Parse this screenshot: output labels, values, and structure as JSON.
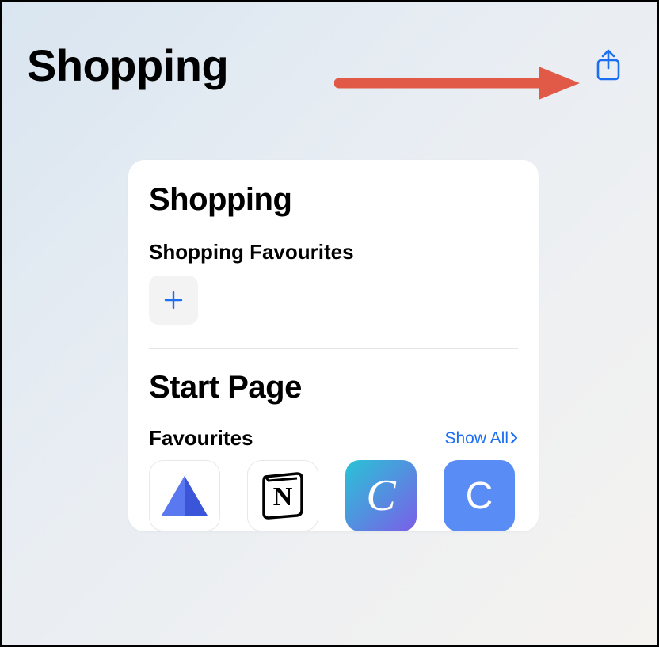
{
  "header": {
    "title": "Shopping"
  },
  "card": {
    "title": "Shopping",
    "favourites_section_title": "Shopping Favourites",
    "start_page_title": "Start Page",
    "favourites_title": "Favourites",
    "show_all_label": "Show All"
  },
  "colors": {
    "accent": "#1d6ff2",
    "annotation": "#e05a47"
  },
  "favourites": [
    {
      "name": "triangle-app"
    },
    {
      "name": "notion-app"
    },
    {
      "name": "canva-app"
    },
    {
      "name": "c-app"
    }
  ]
}
